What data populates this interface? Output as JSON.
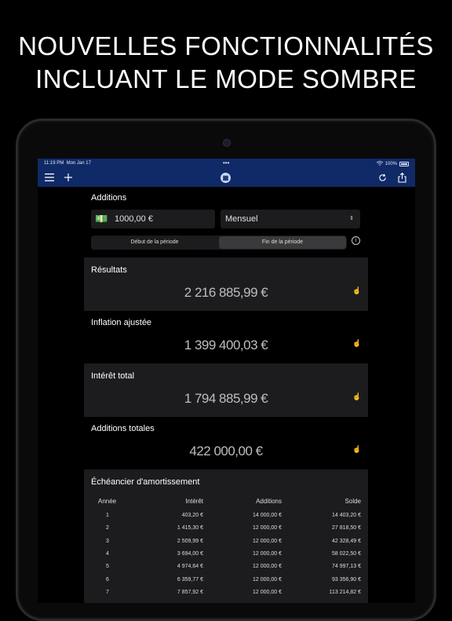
{
  "headline": {
    "line1": "NOUVELLES FONCTIONNALITÉS",
    "line2": "INCLUANT LE MODE SOMBRE"
  },
  "statusbar": {
    "time": "11:19 PM",
    "date": "Mon Jan 17",
    "dots": "•••",
    "battery": "100%"
  },
  "navbar": {
    "menu_icon": "hamburger-icon",
    "add_icon": "plus-icon",
    "logo_icon": "calculator-icon",
    "refresh_icon": "refresh-icon",
    "share_icon": "share-icon"
  },
  "additions": {
    "title": "Additions",
    "amount": "1000,00 €",
    "frequency": "Mensuel",
    "segment": {
      "start": "Début de la période",
      "end": "Fin de la période",
      "selected": "end"
    }
  },
  "results": {
    "title": "Résultats",
    "value": "2 216 885,99 €"
  },
  "inflation": {
    "title": "Inflation ajustée",
    "value": "1 399 400,03 €"
  },
  "interest": {
    "title": "Intérêt total",
    "value": "1 794 885,99 €"
  },
  "total_additions": {
    "title": "Additions totales",
    "value": "422 000,00 €"
  },
  "schedule": {
    "title": "Échéancier d'amortissement",
    "headers": [
      "Année",
      "Intérêt",
      "Additions",
      "Solde"
    ],
    "rows": [
      [
        "1",
        "403,20 €",
        "14 000,00 €",
        "14 403,20 €"
      ],
      [
        "2",
        "1 415,30 €",
        "12 000,00 €",
        "27 818,50 €"
      ],
      [
        "3",
        "2 509,99 €",
        "12 000,00 €",
        "42 328,49 €"
      ],
      [
        "4",
        "3 694,00 €",
        "12 000,00 €",
        "58 022,50 €"
      ],
      [
        "5",
        "4 974,64 €",
        "12 000,00 €",
        "74 997,13 €"
      ],
      [
        "6",
        "6 359,77 €",
        "12 000,00 €",
        "93 356,90 €"
      ],
      [
        "7",
        "7 857,92 €",
        "12 000,00 €",
        "113 214,82 €"
      ]
    ]
  },
  "colors": {
    "navbar": "#0f2a66",
    "card": "#1c1c1e",
    "background": "#000000"
  }
}
